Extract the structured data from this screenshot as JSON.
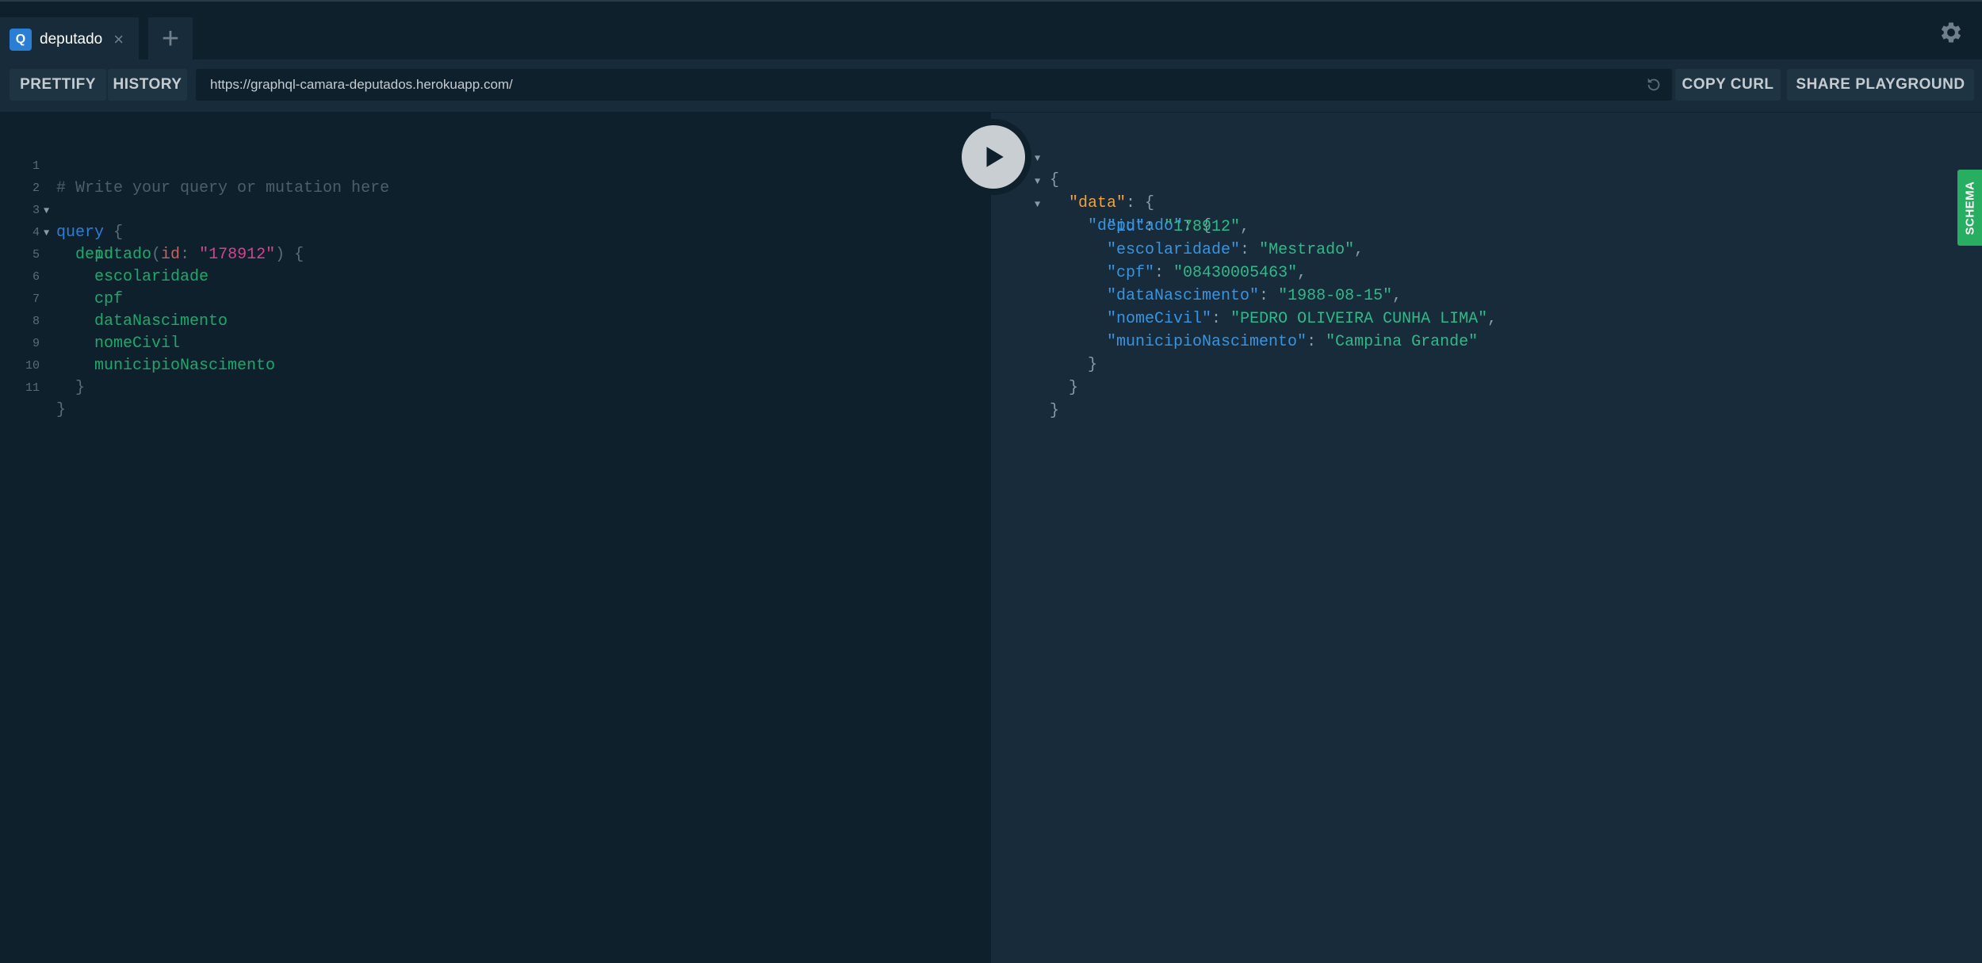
{
  "tabs": [
    {
      "badge": "Q",
      "title": "deputado",
      "close": "×"
    }
  ],
  "add_tab_label": "+",
  "toolbar": {
    "prettify_label": "PRETTIFY",
    "history_label": "HISTORY",
    "endpoint_url": "https://graphql-camara-deputados.herokuapp.com/",
    "copy_curl_label": "COPY CURL",
    "share_label": "SHARE PLAYGROUND"
  },
  "schema_label": "SCHEMA",
  "editor": {
    "line_numbers": [
      "1",
      "2",
      "3",
      "4",
      "5",
      "6",
      "7",
      "8",
      "9",
      "10",
      "11"
    ],
    "comment": "# Write your query or mutation here",
    "keyword": "query",
    "open_brace": "{",
    "close_brace": "}",
    "field_root": "deputado",
    "paren_open": "(",
    "arg_name": "id",
    "colon": ": ",
    "arg_value": "\"178912\"",
    "paren_close_brace": ") {",
    "fields": [
      "id",
      "escolaridade",
      "cpf",
      "dataNascimento",
      "nomeCivil",
      "municipioNascimento"
    ]
  },
  "result": {
    "open": "{",
    "data_key": "\"data\"",
    "deputado_key": "\"deputado\"",
    "colon_brace": ": {",
    "rows": [
      {
        "key": "\"id\"",
        "value": "\"178912\"",
        "comma": ","
      },
      {
        "key": "\"escolaridade\"",
        "value": "\"Mestrado\"",
        "comma": ","
      },
      {
        "key": "\"cpf\"",
        "value": "\"08430005463\"",
        "comma": ","
      },
      {
        "key": "\"dataNascimento\"",
        "value": "\"1988-08-15\"",
        "comma": ","
      },
      {
        "key": "\"nomeCivil\"",
        "value": "\"PEDRO OLIVEIRA CUNHA LIMA\"",
        "comma": ","
      },
      {
        "key": "\"municipioNascimento\"",
        "value": "\"Campina Grande\"",
        "comma": ""
      }
    ],
    "close": "}",
    "colon": ": "
  },
  "colors": {
    "background": "#172b3a",
    "editor_background": "#0f202d",
    "accent_schema": "#27ae60",
    "tab_badge": "#2a7ed3"
  },
  "icons": [
    "settings-gear-icon",
    "reload-icon",
    "play-icon",
    "close-icon",
    "plus-icon",
    "fold-arrow-icon"
  ]
}
